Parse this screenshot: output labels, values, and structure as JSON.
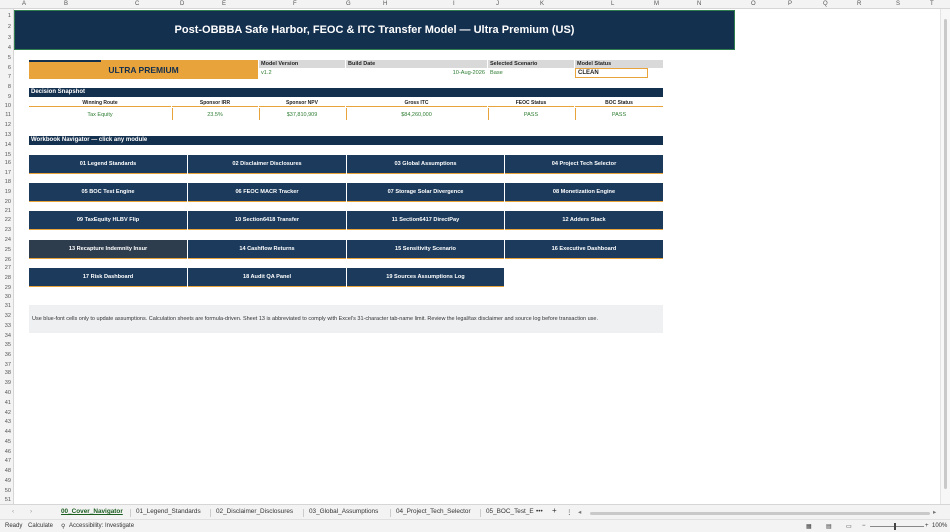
{
  "columns": [
    "A",
    "B",
    "C",
    "D",
    "E",
    "F",
    "G",
    "H",
    "I",
    "J",
    "K",
    "L",
    "M",
    "N",
    "O",
    "P",
    "Q",
    "R",
    "S",
    "T"
  ],
  "rows": [
    "1",
    "2",
    "3",
    "4",
    "5",
    "6",
    "7",
    "8",
    "9",
    "10",
    "11",
    "12",
    "13",
    "14",
    "15",
    "16",
    "17",
    "18",
    "19",
    "20",
    "21",
    "22",
    "23",
    "24",
    "25",
    "26",
    "27",
    "28",
    "29",
    "30",
    "31",
    "32",
    "33",
    "34",
    "35",
    "36",
    "37",
    "38",
    "39",
    "40",
    "41",
    "42",
    "43",
    "44",
    "45",
    "46",
    "47",
    "48",
    "49",
    "50",
    "51"
  ],
  "title": "Post-OBBBA Safe Harbor, FEOC & ITC Transfer Model — Ultra Premium (US)",
  "edition": "ULTRA PREMIUM",
  "meta": {
    "version_label": "Model Version",
    "version_value": "v1.2",
    "build_label": "Build Date",
    "build_value": "10-Aug-2026",
    "scenario_label": "Selected Scenario",
    "scenario_value": "Base",
    "status_label": "Model Status",
    "status_value": "CLEAN"
  },
  "snapshot": {
    "title": "Decision Snapshot",
    "headers": [
      "Winning Route",
      "Sponsor IRR",
      "Sponsor NPV",
      "Gross ITC",
      "FEOC Status",
      "BOC Status"
    ],
    "values": [
      "Tax Equity",
      "23.5%",
      "$37,810,909",
      "$84,260,000",
      "PASS",
      "PASS"
    ]
  },
  "navigator": {
    "title": "Workbook Navigator — click any module",
    "items": [
      "01  Legend Standards",
      "02  Disclaimer Disclosures",
      "03  Global Assumptions",
      "04  Project Tech Selector",
      "05  BOC Test Engine",
      "06  FEOC MACR Tracker",
      "07  Storage Solar Divergence",
      "08  Monetization Engine",
      "09  TaxEquity HLBV Flip",
      "10  Section6418 Transfer",
      "11  Section6417 DirectPay",
      "12  Adders Stack",
      "13  Recapture Indemnity Insur",
      "14  Cashflow Returns",
      "15  Sensitivity Scenario",
      "16  Executive Dashboard",
      "17  Risk Dashboard",
      "18  Audit QA Panel",
      "19  Sources Assumptions Log"
    ]
  },
  "note": "Use blue-font cells only to update assumptions. Calculation sheets are formula-driven. Sheet 13 is abbreviated to comply with Excel's 31-character tab-name limit. Review the legal/tax disclaimer and source log before transaction use.",
  "tabs": [
    "00_Cover_Navigator",
    "01_Legend_Standards",
    "02_Disclaimer_Disclosures",
    "03_Global_Assumptions",
    "04_Project_Tech_Selector",
    "05_BOC_Test_E"
  ],
  "status": {
    "ready": "Ready",
    "calculate": "Calculate",
    "accessibility": "Accessibility: Investigate",
    "zoom": "100%"
  }
}
